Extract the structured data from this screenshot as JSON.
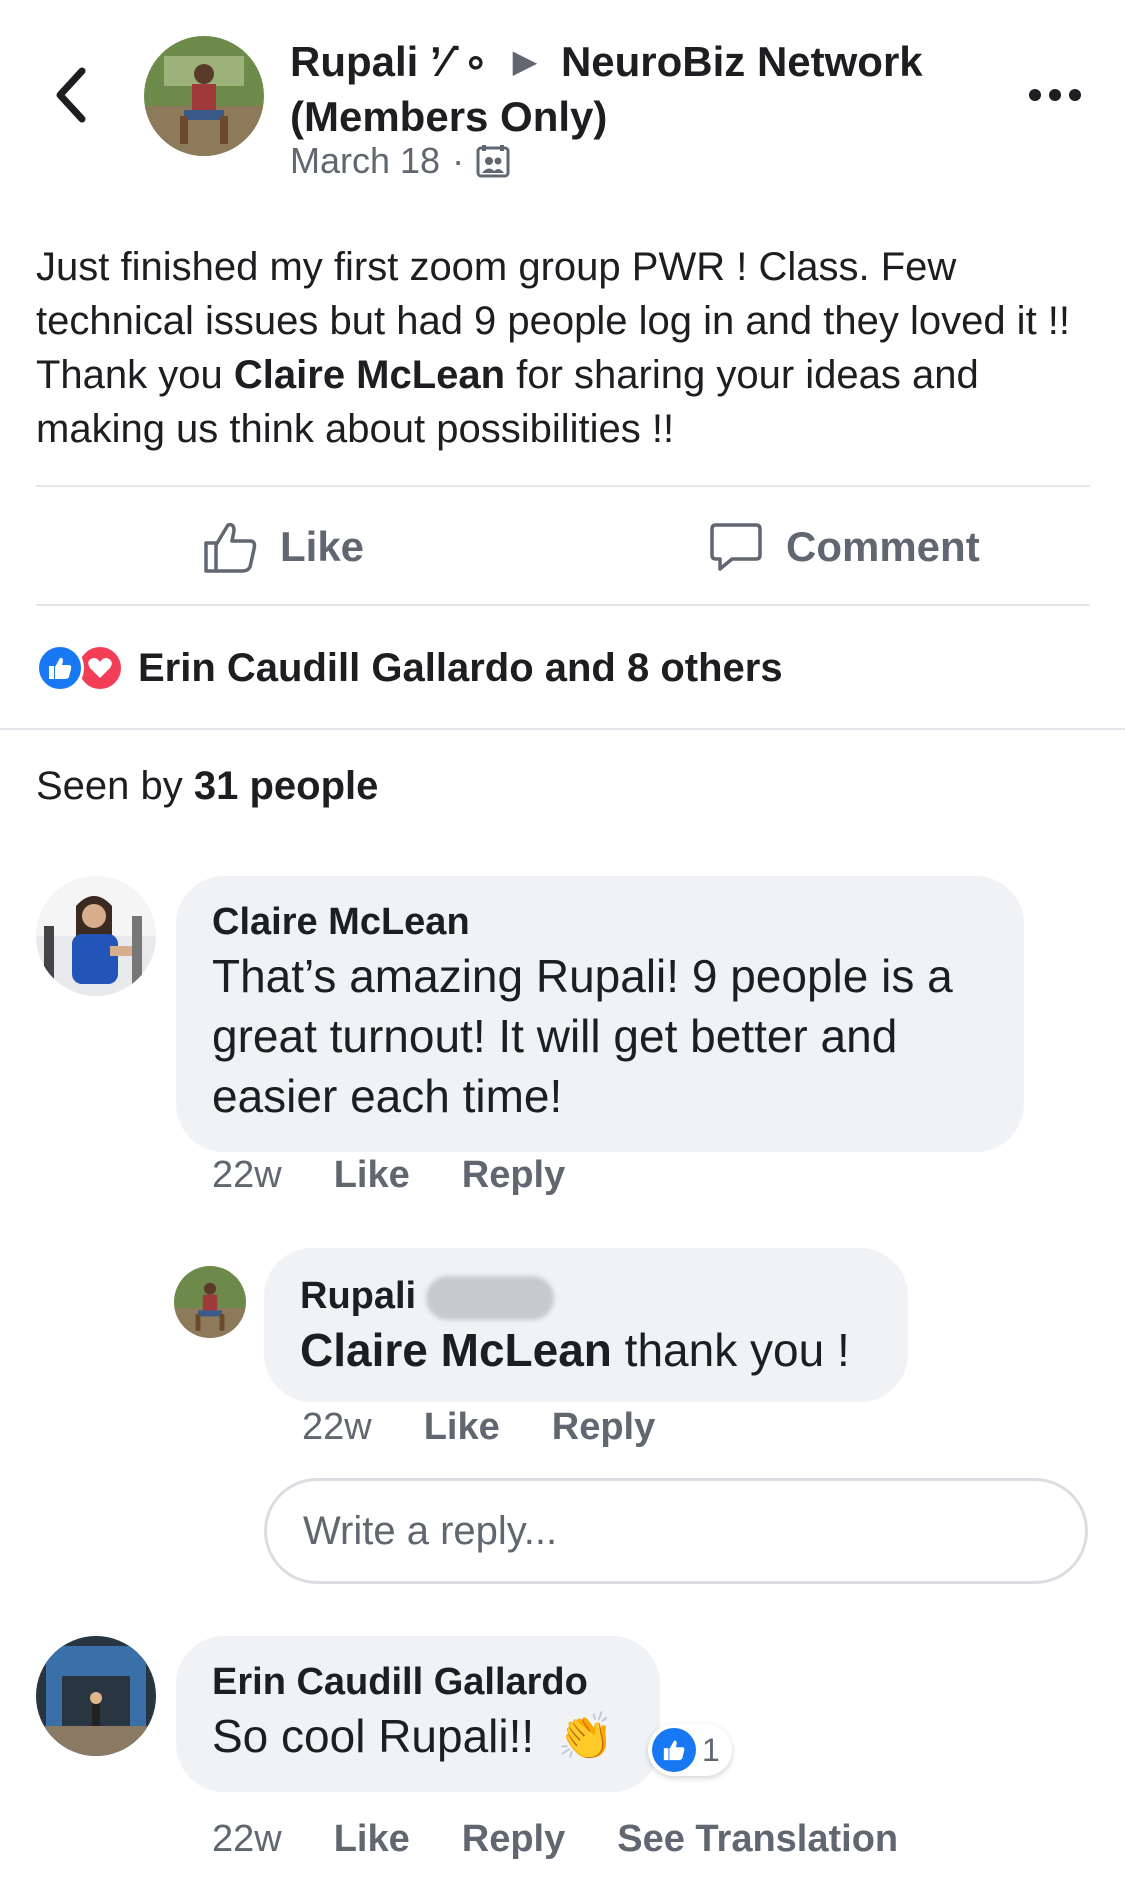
{
  "header": {
    "author": "Rupali",
    "author_obscured": "’⁄˙∘",
    "group": "NeuroBiz Network (Members Only)",
    "date": "March 18",
    "separator": "·",
    "privacy_icon": "group-privacy-icon"
  },
  "post": {
    "text_before": "Just finished my first zoom group PWR ! Class. Few technical issues but had 9 people log in and they loved it !! Thank you ",
    "mention": "Claire McLean",
    "text_after": " for sharing your ideas and making us think about possibilities !!"
  },
  "actions": {
    "like_label": "Like",
    "comment_label": "Comment"
  },
  "reactions": {
    "text": "Erin Caudill Gallardo and 8 others",
    "icons": [
      "like-reaction-icon",
      "love-reaction-icon"
    ]
  },
  "seen": {
    "prefix": "Seen by ",
    "count_text": "31 people"
  },
  "comments": [
    {
      "name": "Claire McLean",
      "text": "That’s amazing Rupali! 9 people is a great turnout! It will get better and easier each time!",
      "time": "22w",
      "like_label": "Like",
      "reply_label": "Reply"
    },
    {
      "name": "Rupali",
      "mention": "Claire McLean",
      "text": " thank you !",
      "time": "22w",
      "like_label": "Like",
      "reply_label": "Reply"
    },
    {
      "name": "Erin Caudill Gallardo",
      "text": "So cool Rupali!!",
      "emoji": "👏",
      "like_count": "1",
      "time": "22w",
      "like_label": "Like",
      "reply_label": "Reply",
      "translate_label": "See Translation"
    }
  ],
  "reply_input": {
    "placeholder": "Write a reply..."
  },
  "colors": {
    "text": "#1c1e21",
    "secondary": "#606770",
    "bubble": "#f0f2f5",
    "like_blue": "#1877f2",
    "love_red": "#f33e58"
  }
}
